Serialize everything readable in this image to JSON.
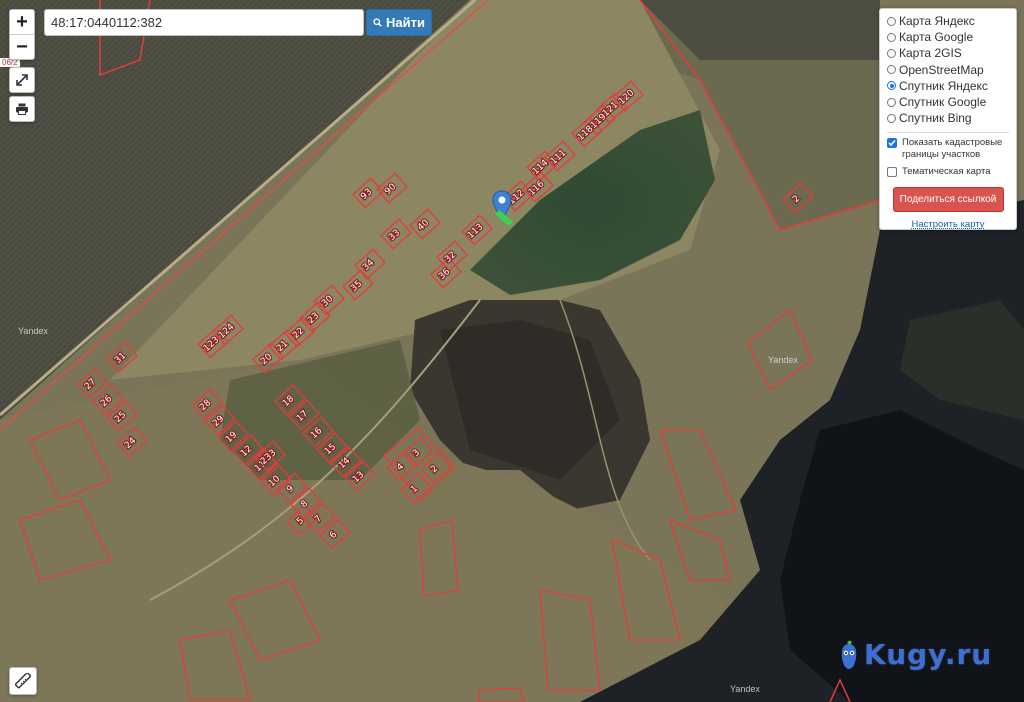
{
  "search": {
    "value": "48:17:0440112:382",
    "button_label": "Найти"
  },
  "zoom": {
    "in_label": "+",
    "out_label": "−"
  },
  "layers": {
    "options": [
      {
        "label": "Карта Яндекс",
        "selected": false
      },
      {
        "label": "Карта Google",
        "selected": false
      },
      {
        "label": "Карта 2GIS",
        "selected": false
      },
      {
        "label": "OpenStreetMap",
        "selected": false
      },
      {
        "label": "Спутник Яндекс",
        "selected": true
      },
      {
        "label": "Спутник Google",
        "selected": false
      },
      {
        "label": "Спутник Bing",
        "selected": false
      }
    ],
    "show_borders_label": "Показать кадастровые границы участков",
    "show_borders_checked": true,
    "thematic_label": "Тематическая карта",
    "thematic_checked": false,
    "share_label": "Поделиться ссылкой",
    "configure_label": "Настроить карту"
  },
  "map": {
    "attribution": "Yandex",
    "side_label": "06/2",
    "parcel_labels": [
      "120",
      "121",
      "119",
      "118",
      "111",
      "114",
      "116",
      "112",
      "113",
      "93",
      "90",
      "40",
      "33",
      "32",
      "36",
      "34",
      "35",
      "30",
      "23",
      "22",
      "21",
      "20",
      "124",
      "123",
      "27",
      "26",
      "25",
      "24",
      "28",
      "29",
      "18",
      "17",
      "16",
      "15",
      "14",
      "13",
      "19",
      "12",
      "11",
      "10",
      "233",
      "9",
      "8",
      "7",
      "6",
      "5",
      "4",
      "3",
      "2",
      "1",
      "31",
      "2"
    ],
    "logo_text": "Kugy.ru",
    "colors": {
      "parcel": "#e63b3b",
      "accent": "#337ab7",
      "share": "#d9534f"
    }
  }
}
